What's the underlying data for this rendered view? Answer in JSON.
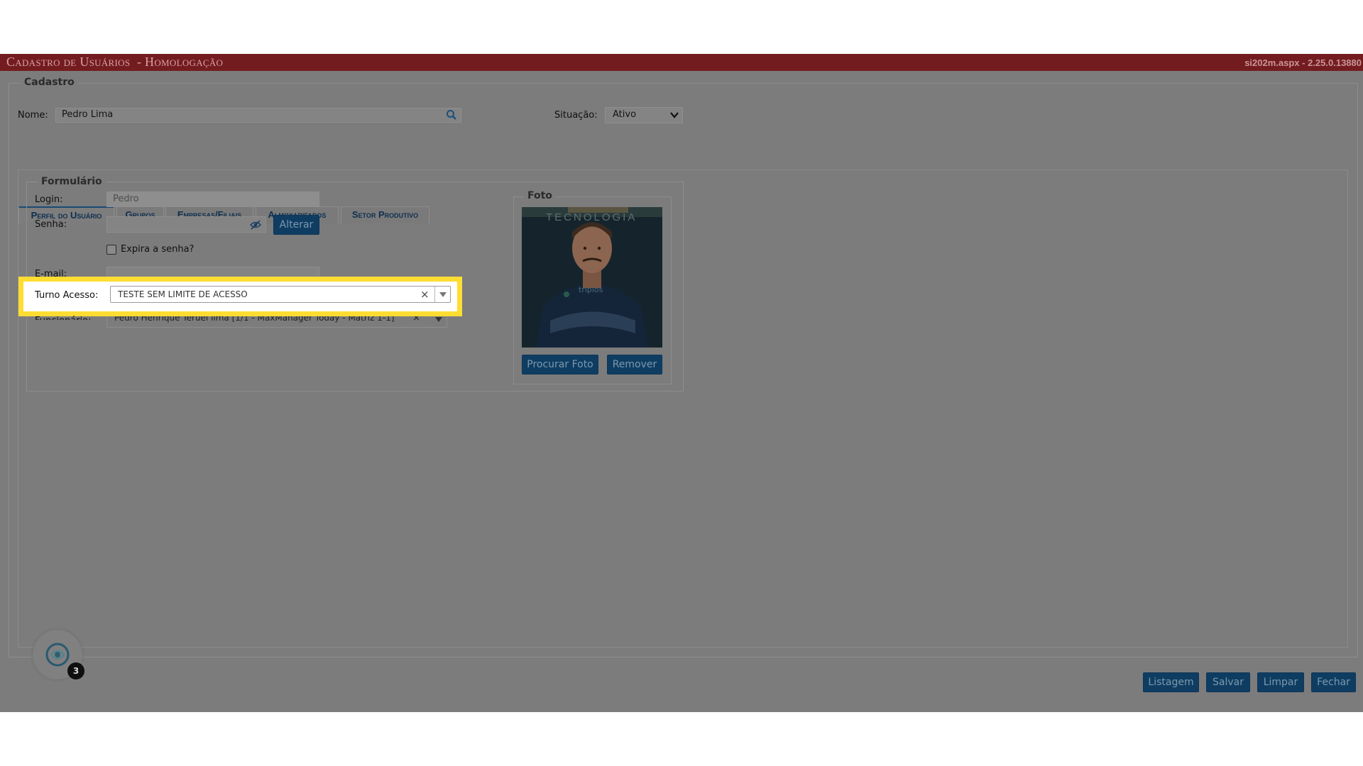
{
  "header": {
    "title": "Cadastro de Usuários  - Homologação",
    "version": "si202m.aspx - 2.25.0.13880"
  },
  "cadastro": {
    "legend": "Cadastro",
    "nome_label": "Nome:",
    "nome_value": "Pedro Lima",
    "situacao_label": "Situação:",
    "situacao_value": "Ativo"
  },
  "tabs": [
    {
      "label": "Perfil do Usuário",
      "active": true
    },
    {
      "label": "Grupos"
    },
    {
      "label": "Empresas/Filiais"
    },
    {
      "label": "Almoxarifados"
    },
    {
      "label": "Setor Produtivo"
    }
  ],
  "form": {
    "legend": "Formulário",
    "login_label": "Login:",
    "login_value": "Pedro",
    "senha_label": "Senha:",
    "senha_value": "",
    "alterar_label": "Alterar",
    "expira_label": "Expira a senha?",
    "email_label": "E-mail:",
    "turno_label": "Turno Acesso:",
    "turno_value": "TESTE SEM LIMITE DE ACESSO",
    "funcionario_label": "Funcionário:",
    "funcionario_value": "Pedro Henrique Teruel lima [1/1 - MaxManager Today - Matriz 1-1]"
  },
  "foto": {
    "legend": "Foto",
    "photo_text": "TECNOLOGIA",
    "shirt_text": "triplos",
    "procurar_label": "Procurar Foto",
    "remover_label": "Remover"
  },
  "chat": {
    "badge_count": "3"
  },
  "footer": {
    "listagem": "Listagem",
    "salvar": "Salvar",
    "limpar": "Limpar",
    "fechar": "Fechar"
  },
  "colors": {
    "header_bg": "#731c1f",
    "highlight": "#ffdd33",
    "button_bg": "#0f3d62",
    "overlay_bg": "#7c7c7c"
  },
  "icons": [
    "search-icon",
    "eye-off-icon",
    "clear-icon",
    "chevron-down-icon",
    "chat-icon"
  ]
}
